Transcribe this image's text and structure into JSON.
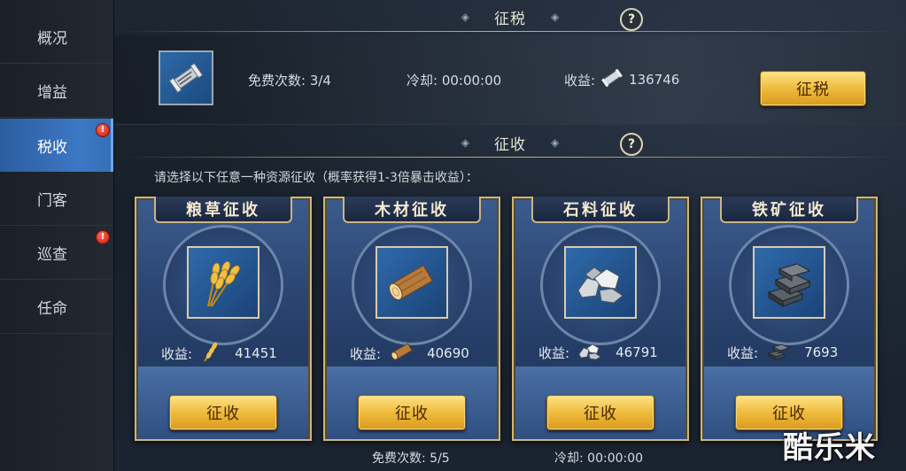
{
  "sidebar": {
    "items": [
      {
        "label": "概况",
        "badge": false,
        "active": false
      },
      {
        "label": "增益",
        "badge": false,
        "active": false
      },
      {
        "label": "税收",
        "badge": true,
        "active": true
      },
      {
        "label": "门客",
        "badge": false,
        "active": false
      },
      {
        "label": "巡查",
        "badge": true,
        "active": false
      },
      {
        "label": "任命",
        "badge": false,
        "active": false
      }
    ],
    "badge_text": "!"
  },
  "tax": {
    "title": "征税",
    "help": "?",
    "free_label": "免费次数: 3/4",
    "cooldown_label": "冷却: 00:00:00",
    "income_label": "收益:",
    "income_value": "136746",
    "button": "征税"
  },
  "collect": {
    "title": "征收",
    "help": "?",
    "instruction": "请选择以下任意一种资源征收（概率获得1-3倍暴击收益）：",
    "yield_label": "收益:",
    "cards": [
      {
        "title": "粮草征收",
        "icon": "wheat-icon",
        "value": "41451",
        "button": "征收"
      },
      {
        "title": "木材征收",
        "icon": "wood-log-icon",
        "value": "40690",
        "button": "征收"
      },
      {
        "title": "石料征收",
        "icon": "stone-icon",
        "value": "46791",
        "button": "征收"
      },
      {
        "title": "铁矿征收",
        "icon": "iron-ingot-icon",
        "value": "7693",
        "button": "征收"
      }
    ],
    "free_label": "免费次数: 5/5",
    "cooldown_label": "冷却: 00:00:00"
  },
  "watermark": "酷乐米",
  "colors": {
    "accent_gold": "#f1bf42",
    "active_tab": "#3c78c4",
    "badge_red": "#c8170c"
  }
}
